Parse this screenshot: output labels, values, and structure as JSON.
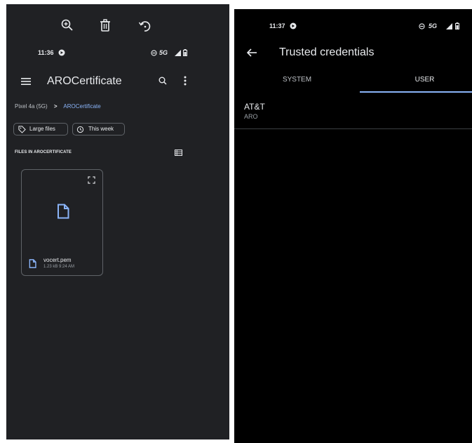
{
  "left": {
    "status": {
      "time": "11:36",
      "network": "5G"
    },
    "appbar": {
      "title": "AROCertificate"
    },
    "breadcrumb": {
      "root": "Pixel 4a (5G)",
      "separator": ">",
      "current": "AROCertificate"
    },
    "chips": [
      {
        "label": "Large files"
      },
      {
        "label": "This week"
      }
    ],
    "section_header": "FILES IN AROCERTIFICATE",
    "file": {
      "name": "vocert.pem",
      "meta": "1.23 kB 9:24 AM"
    }
  },
  "right": {
    "status": {
      "time": "11:37",
      "network": "5G"
    },
    "appbar": {
      "title": "Trusted credentials"
    },
    "tabs": [
      {
        "label": "SYSTEM"
      },
      {
        "label": "USER"
      }
    ],
    "credential": {
      "title": "AT&T",
      "subtitle": "ARO"
    }
  },
  "colors": {
    "accent": "#8ab4f8",
    "dark_surface": "#202124",
    "black": "#000000"
  }
}
